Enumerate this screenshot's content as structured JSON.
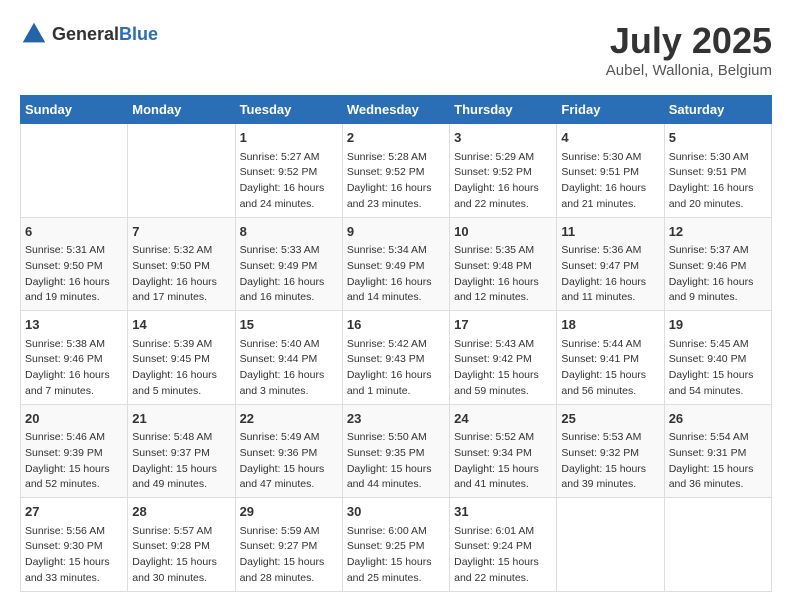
{
  "header": {
    "logo_general": "General",
    "logo_blue": "Blue",
    "title": "July 2025",
    "location": "Aubel, Wallonia, Belgium"
  },
  "calendar": {
    "days_of_week": [
      "Sunday",
      "Monday",
      "Tuesday",
      "Wednesday",
      "Thursday",
      "Friday",
      "Saturday"
    ],
    "weeks": [
      [
        {
          "day": "",
          "content": ""
        },
        {
          "day": "",
          "content": ""
        },
        {
          "day": "1",
          "content": "Sunrise: 5:27 AM\nSunset: 9:52 PM\nDaylight: 16 hours and 24 minutes."
        },
        {
          "day": "2",
          "content": "Sunrise: 5:28 AM\nSunset: 9:52 PM\nDaylight: 16 hours and 23 minutes."
        },
        {
          "day": "3",
          "content": "Sunrise: 5:29 AM\nSunset: 9:52 PM\nDaylight: 16 hours and 22 minutes."
        },
        {
          "day": "4",
          "content": "Sunrise: 5:30 AM\nSunset: 9:51 PM\nDaylight: 16 hours and 21 minutes."
        },
        {
          "day": "5",
          "content": "Sunrise: 5:30 AM\nSunset: 9:51 PM\nDaylight: 16 hours and 20 minutes."
        }
      ],
      [
        {
          "day": "6",
          "content": "Sunrise: 5:31 AM\nSunset: 9:50 PM\nDaylight: 16 hours and 19 minutes."
        },
        {
          "day": "7",
          "content": "Sunrise: 5:32 AM\nSunset: 9:50 PM\nDaylight: 16 hours and 17 minutes."
        },
        {
          "day": "8",
          "content": "Sunrise: 5:33 AM\nSunset: 9:49 PM\nDaylight: 16 hours and 16 minutes."
        },
        {
          "day": "9",
          "content": "Sunrise: 5:34 AM\nSunset: 9:49 PM\nDaylight: 16 hours and 14 minutes."
        },
        {
          "day": "10",
          "content": "Sunrise: 5:35 AM\nSunset: 9:48 PM\nDaylight: 16 hours and 12 minutes."
        },
        {
          "day": "11",
          "content": "Sunrise: 5:36 AM\nSunset: 9:47 PM\nDaylight: 16 hours and 11 minutes."
        },
        {
          "day": "12",
          "content": "Sunrise: 5:37 AM\nSunset: 9:46 PM\nDaylight: 16 hours and 9 minutes."
        }
      ],
      [
        {
          "day": "13",
          "content": "Sunrise: 5:38 AM\nSunset: 9:46 PM\nDaylight: 16 hours and 7 minutes."
        },
        {
          "day": "14",
          "content": "Sunrise: 5:39 AM\nSunset: 9:45 PM\nDaylight: 16 hours and 5 minutes."
        },
        {
          "day": "15",
          "content": "Sunrise: 5:40 AM\nSunset: 9:44 PM\nDaylight: 16 hours and 3 minutes."
        },
        {
          "day": "16",
          "content": "Sunrise: 5:42 AM\nSunset: 9:43 PM\nDaylight: 16 hours and 1 minute."
        },
        {
          "day": "17",
          "content": "Sunrise: 5:43 AM\nSunset: 9:42 PM\nDaylight: 15 hours and 59 minutes."
        },
        {
          "day": "18",
          "content": "Sunrise: 5:44 AM\nSunset: 9:41 PM\nDaylight: 15 hours and 56 minutes."
        },
        {
          "day": "19",
          "content": "Sunrise: 5:45 AM\nSunset: 9:40 PM\nDaylight: 15 hours and 54 minutes."
        }
      ],
      [
        {
          "day": "20",
          "content": "Sunrise: 5:46 AM\nSunset: 9:39 PM\nDaylight: 15 hours and 52 minutes."
        },
        {
          "day": "21",
          "content": "Sunrise: 5:48 AM\nSunset: 9:37 PM\nDaylight: 15 hours and 49 minutes."
        },
        {
          "day": "22",
          "content": "Sunrise: 5:49 AM\nSunset: 9:36 PM\nDaylight: 15 hours and 47 minutes."
        },
        {
          "day": "23",
          "content": "Sunrise: 5:50 AM\nSunset: 9:35 PM\nDaylight: 15 hours and 44 minutes."
        },
        {
          "day": "24",
          "content": "Sunrise: 5:52 AM\nSunset: 9:34 PM\nDaylight: 15 hours and 41 minutes."
        },
        {
          "day": "25",
          "content": "Sunrise: 5:53 AM\nSunset: 9:32 PM\nDaylight: 15 hours and 39 minutes."
        },
        {
          "day": "26",
          "content": "Sunrise: 5:54 AM\nSunset: 9:31 PM\nDaylight: 15 hours and 36 minutes."
        }
      ],
      [
        {
          "day": "27",
          "content": "Sunrise: 5:56 AM\nSunset: 9:30 PM\nDaylight: 15 hours and 33 minutes."
        },
        {
          "day": "28",
          "content": "Sunrise: 5:57 AM\nSunset: 9:28 PM\nDaylight: 15 hours and 30 minutes."
        },
        {
          "day": "29",
          "content": "Sunrise: 5:59 AM\nSunset: 9:27 PM\nDaylight: 15 hours and 28 minutes."
        },
        {
          "day": "30",
          "content": "Sunrise: 6:00 AM\nSunset: 9:25 PM\nDaylight: 15 hours and 25 minutes."
        },
        {
          "day": "31",
          "content": "Sunrise: 6:01 AM\nSunset: 9:24 PM\nDaylight: 15 hours and 22 minutes."
        },
        {
          "day": "",
          "content": ""
        },
        {
          "day": "",
          "content": ""
        }
      ]
    ]
  }
}
